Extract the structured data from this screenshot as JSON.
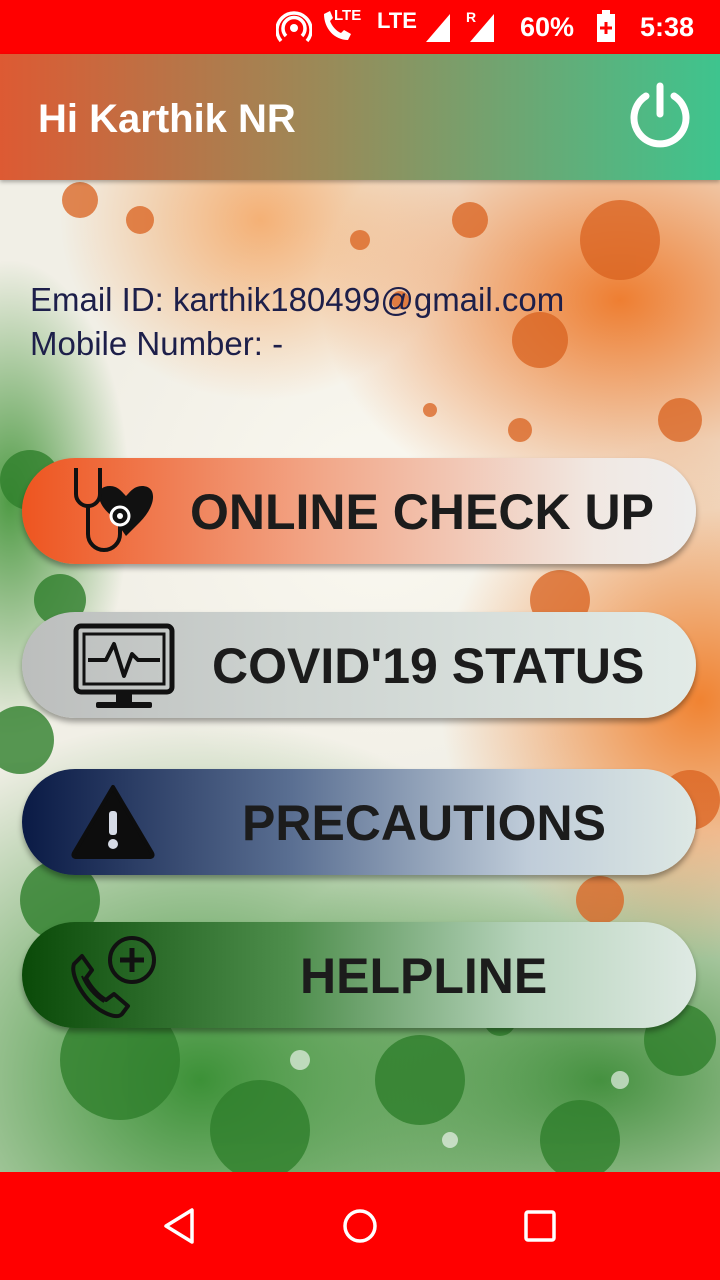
{
  "status_bar": {
    "lte1": "LTE",
    "lte2": "LTE",
    "roaming": "R",
    "battery": "60%",
    "time": "5:38"
  },
  "app_bar": {
    "title": "Hi Karthik NR",
    "power_icon": "power-icon"
  },
  "profile": {
    "email_line": "Email ID: karthik180499@gmail.com",
    "mobile_line": "Mobile Number: -"
  },
  "actions": [
    {
      "label": "ONLINE CHECK UP",
      "icon": "stethoscope-heart-icon"
    },
    {
      "label": "COVID'19 STATUS",
      "icon": "monitor-pulse-icon"
    },
    {
      "label": "PRECAUTIONS",
      "icon": "warning-icon"
    },
    {
      "label": "HELPLINE",
      "icon": "phone-add-icon"
    }
  ],
  "nav": {
    "back": "back-icon",
    "home": "home-icon",
    "recents": "recents-icon"
  },
  "colors": {
    "status_bar": "#ff0000",
    "nav_bar": "#ff0000",
    "text_dark": "#1d1f4a"
  }
}
